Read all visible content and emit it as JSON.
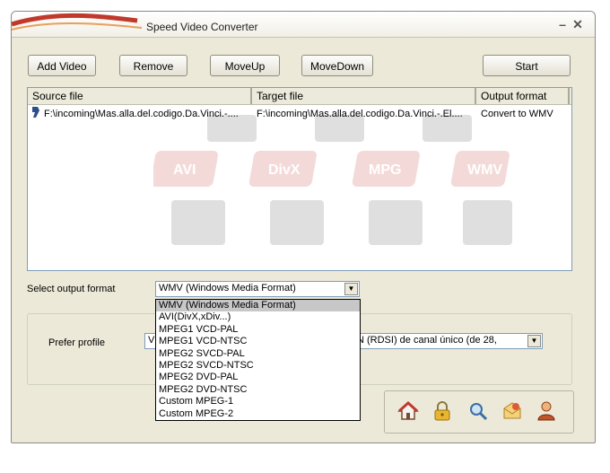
{
  "window": {
    "title": "Speed Video Converter",
    "accent_color": "#c0392b"
  },
  "toolbar": {
    "add_video": "Add Video",
    "remove": "Remove",
    "move_up": "MoveUp",
    "move_down": "MoveDown",
    "start": "Start"
  },
  "file_list": {
    "columns": [
      "Source file",
      "Target file",
      "Output format"
    ],
    "rows": [
      {
        "source": "F:\\incoming\\Mas.alla.del.codigo.Da.Vinci.-....",
        "target": "F:\\incoming\\Mas.alla.del.codigo.Da.Vinci.-.El....",
        "format": "Convert to WMV"
      }
    ],
    "watermark_labels": [
      "AVI",
      "DivX",
      "MPG",
      "WMV"
    ]
  },
  "output_format": {
    "label": "Select output format",
    "selected": "WMV (Windows Media Format)",
    "options": [
      "WMV (Windows Media Format)",
      "AVI(DivX,xDiv...)",
      "MPEG1 VCD-PAL",
      "MPEG1 VCD-NTSC",
      "MPEG2 SVCD-PAL",
      "MPEG2 SVCD-NTSC",
      "MPEG2 DVD-PAL",
      "MPEG2 DVD-NTSC",
      "Custom MPEG-1",
      "Custom MPEG-2"
    ]
  },
  "profile": {
    "label": "Prefer profile",
    "value_prefix": "V",
    "value_tail": "N (RDSI) de canal único (de 28,"
  },
  "bottom_icons": [
    "home-icon",
    "lock-icon",
    "search-icon",
    "mail-icon",
    "user-icon"
  ]
}
